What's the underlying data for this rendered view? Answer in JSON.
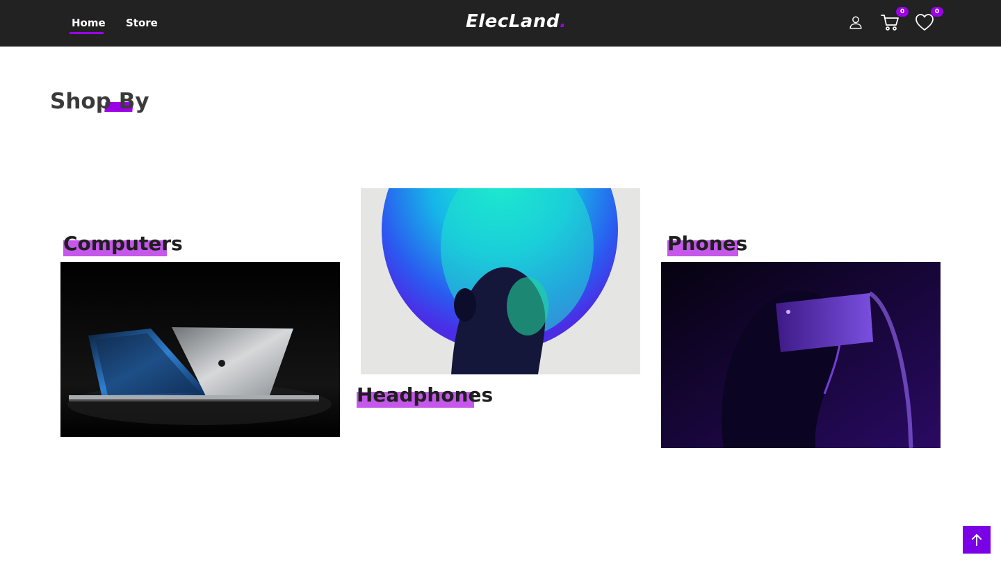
{
  "nav": {
    "home_label": "Home",
    "store_label": "Store"
  },
  "logo": {
    "text": "ElecLand",
    "dot": ".",
    "accent": "#9b00e6"
  },
  "header_icons": {
    "user": "user-icon",
    "cart": "cart-icon",
    "wishlist": "heart-icon",
    "cart_count": "0",
    "wishlist_count": "0"
  },
  "section": {
    "title_start": "Shop ",
    "title_end": "By"
  },
  "categories": [
    {
      "label": "Computers"
    },
    {
      "label": "Headphones"
    },
    {
      "label": "Phones"
    }
  ],
  "scroll_top": {
    "icon": "arrow-up-icon"
  },
  "colors": {
    "navbar": "#222222",
    "accent": "#9b00e6",
    "label_highlight": "#c557ea",
    "scroll_top": "#7a00e6"
  }
}
